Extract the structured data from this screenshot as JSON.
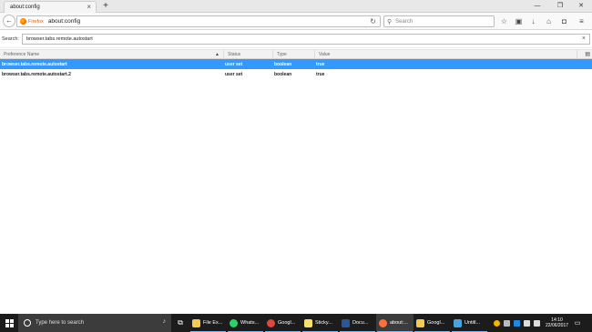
{
  "browser": {
    "tab_title": "about:config",
    "url": "about:config",
    "identity_label": "Firefox",
    "search_placeholder": "Search"
  },
  "filter": {
    "label": "Search:",
    "value": "browser.tabs.remote.autostart"
  },
  "table": {
    "columns": [
      "Preference Name",
      "Status",
      "Type",
      "Value"
    ],
    "rows": [
      {
        "name": "browser.tabs.remote.autostart",
        "status": "user set",
        "type": "boolean",
        "value": "true"
      },
      {
        "name": "browser.tabs.remote.autostart.2",
        "status": "user set",
        "type": "boolean",
        "value": "true"
      }
    ]
  },
  "taskbar": {
    "search_placeholder": "Type here to search",
    "apps": [
      {
        "label": "File Ex...",
        "color": "#f6c94f"
      },
      {
        "label": "Whats...",
        "color": "#25d366"
      },
      {
        "label": "Googl...",
        "color": "#e0463a"
      },
      {
        "label": "Sticky...",
        "color": "#f7e36a"
      },
      {
        "label": "Docu...",
        "color": "#2b579a"
      },
      {
        "label": "about:...",
        "color": "#ff7139"
      },
      {
        "label": "Googl...",
        "color": "#f6c94f"
      },
      {
        "label": "Untitl...",
        "color": "#4aa3df"
      }
    ],
    "time": "14:10",
    "date": "22/06/2017"
  },
  "colors": {
    "selection": "#3399ff",
    "taskbar": "#1c1c1c"
  }
}
